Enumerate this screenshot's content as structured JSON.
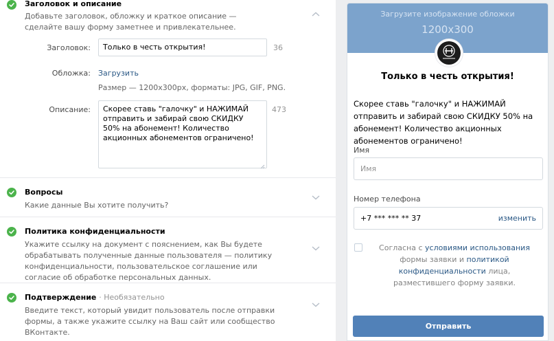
{
  "sections": {
    "header": {
      "title": "Заголовок и описание",
      "desc": "Добавьте заголовок, обложку и краткое описание — сделайте вашу форму заметнее и привлекательнее.",
      "title_label": "Заголовок:",
      "title_value": "Только в честь открытия!",
      "title_counter": "36",
      "cover_label": "Обложка:",
      "cover_link": "Загрузить",
      "cover_hint": "Размер — 1200x300px, форматы: JPG, GIF, PNG.",
      "desc_label": "Описание:",
      "desc_value": "Скорее ставь \"галочку\" и НАЖИМАЙ отправить и забирай свою СКИДКУ 50% на абонемент! Количество акционных абонементов ограничено!",
      "desc_counter": "473"
    },
    "questions": {
      "title": "Вопросы",
      "desc": "Какие данные Вы хотите получить?"
    },
    "privacy": {
      "title": "Политика конфиденциальности",
      "desc": "Укажите ссылку на документ с пояснением, как Вы будете обрабатывать полученные данные пользователя — политику конфиденциальности, пользовательское соглашение или согласие об обработке персональных данных."
    },
    "confirm": {
      "title": "Подтверждение",
      "optional": "· Необязательно",
      "desc": "Введите текст, который увидит пользователь после отправки формы, а также укажите ссылку на Ваш сайт или сообщество ВКонтакте."
    }
  },
  "preview": {
    "cover_text": "Загрузите изображение обложки",
    "cover_size": "1200x300",
    "title": "Только в честь открытия!",
    "description": "Скорее ставь \"галочку\" и НАЖИМАЙ отправить и забирай свою СКИДКУ 50% на абонемент! Количество акционных абонементов ограничено!",
    "name_label": "Имя",
    "name_placeholder": "Имя",
    "phone_label": "Номер телефона",
    "phone_value": "+7 *** *** ** 37",
    "phone_change": "изменить",
    "consent_pre": "Согласна с",
    "consent_link1": "условиями использования",
    "consent_mid": "формы заявки и",
    "consent_link2": "политикой конфиденциальности",
    "consent_post": "лица, разместившего форму заявки.",
    "submit": "Отправить"
  },
  "colors": {
    "accent": "#5181b8",
    "check": "#4bb34b",
    "cover": "#7ca3cc",
    "link": "#2a5885"
  }
}
